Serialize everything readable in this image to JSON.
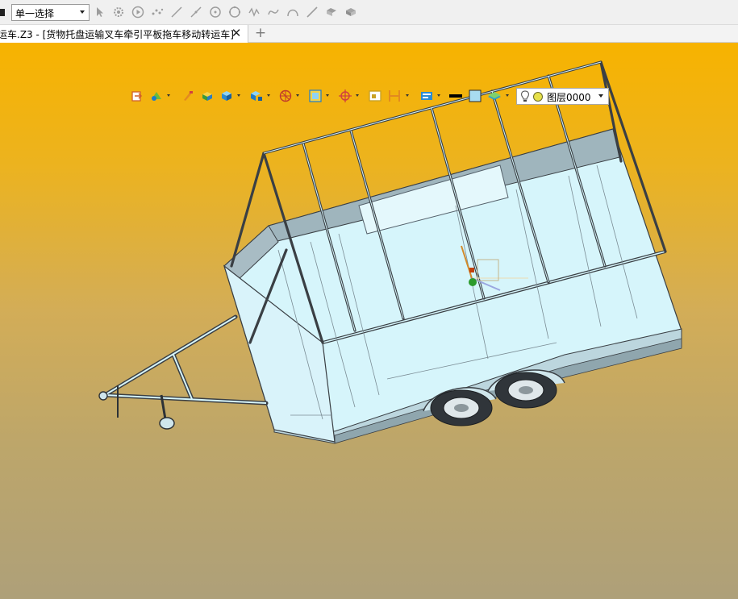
{
  "toolbar": {
    "selection_filter": "单一选择",
    "icons": [
      "cursor-icon",
      "gear-pick-icon",
      "play-icon",
      "points-icon",
      "line-icon",
      "diagonal-line-icon",
      "circle-center-icon",
      "circle-icon",
      "curve-icon",
      "spline-icon",
      "arc-icon",
      "line-tangent-icon",
      "face-icon",
      "solid-icon"
    ]
  },
  "tab": {
    "title": "运车.Z3 - [货物托盘运输叉车牵引平板拖车移动转运车]",
    "close_symbol": "✕",
    "new_tab_symbol": "+"
  },
  "view_toolbar": {
    "icons": [
      "exit-sketch-icon",
      "view-paint-icon",
      "brush-icon",
      "box-shaded-icon",
      "cube-icon",
      "view-orient-icon",
      "render-mode-icon",
      "section-icon",
      "zoom-fit-icon",
      "snap-target-icon",
      "frame-icon",
      "dimension-icon",
      "display-filter-icon",
      "line-color-icon",
      "fill-color-icon",
      "layer-stack-icon"
    ],
    "layer": {
      "name": "图层0000",
      "light_color": "#e6e04a"
    }
  },
  "viewport": {
    "background_top": "#f7b300",
    "background_bottom": "#aea079",
    "model_fill": "#d6f5fb",
    "frame_color": "#3a3f44"
  }
}
